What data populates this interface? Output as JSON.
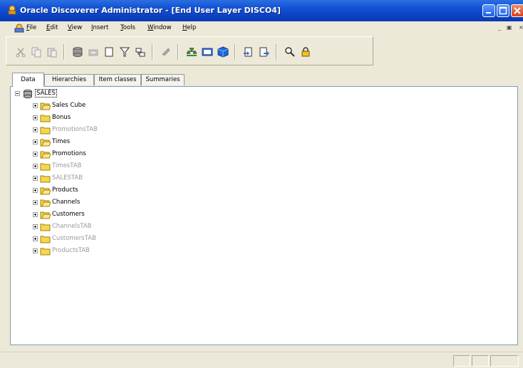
{
  "window": {
    "title": "Oracle Discoverer Administrator - [End User Layer  DISCO4]"
  },
  "menu": {
    "items": [
      "File",
      "Edit",
      "View",
      "Insert",
      "Tools",
      "Window",
      "Help"
    ],
    "mnemonics": [
      "F",
      "E",
      "V",
      "I",
      "T",
      "W",
      "H"
    ]
  },
  "tabs": [
    {
      "label": "Data",
      "active": true
    },
    {
      "label": "Hierarchies",
      "active": false
    },
    {
      "label": "Item classes",
      "active": false
    },
    {
      "label": "Summaries",
      "active": false
    }
  ],
  "tree": {
    "root": "SALES",
    "items": [
      {
        "label": "Sales Cube",
        "icon": "folder-open-icon",
        "dim": false
      },
      {
        "label": "Bonus",
        "icon": "folder-icon",
        "dim": false
      },
      {
        "label": "PromotionsTAB",
        "icon": "folder-icon",
        "dim": true
      },
      {
        "label": "Times",
        "icon": "folder-open-icon",
        "dim": false
      },
      {
        "label": "Promotions",
        "icon": "folder-open-icon",
        "dim": false
      },
      {
        "label": "TimesTAB",
        "icon": "folder-icon",
        "dim": true
      },
      {
        "label": "SALESTAB",
        "icon": "folder-icon",
        "dim": true
      },
      {
        "label": "Products",
        "icon": "folder-open-icon",
        "dim": false
      },
      {
        "label": "Channels",
        "icon": "folder-open-icon",
        "dim": false
      },
      {
        "label": "Customers",
        "icon": "folder-open-icon",
        "dim": false
      },
      {
        "label": "ChannelsTAB",
        "icon": "folder-icon",
        "dim": true
      },
      {
        "label": "CustomersTAB",
        "icon": "folder-icon",
        "dim": true
      },
      {
        "label": "ProductsTAB",
        "icon": "folder-icon",
        "dim": true
      }
    ]
  },
  "colors": {
    "titlebar": "#0a3fbf",
    "folder": "#f5d84a",
    "dim_text": "#9a9a9a"
  }
}
